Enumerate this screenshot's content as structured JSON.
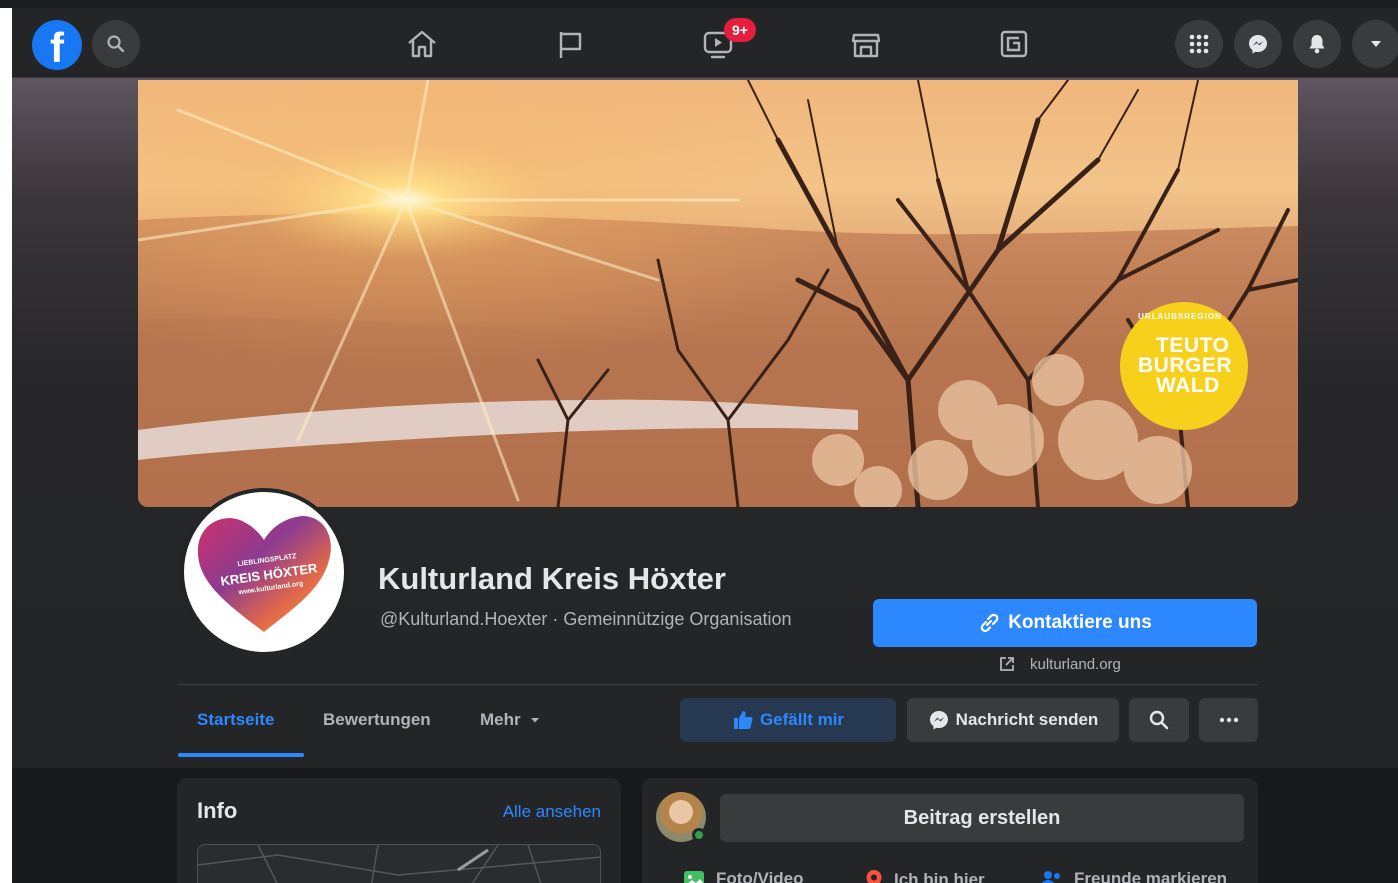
{
  "colors": {
    "background": "#18191a",
    "surface": "#242526",
    "accent": "#2d88ff",
    "notification": "#e41e3f",
    "brand_yellow": "#f7d01c"
  },
  "topnav": {
    "logo_letter": "f",
    "icons": [
      "search-icon",
      "home-icon",
      "flag-icon",
      "watch-icon",
      "marketplace-icon",
      "gaming-icon",
      "menu-grid-icon",
      "messenger-icon",
      "bell-icon",
      "caret-down-icon"
    ],
    "watch_badge": "9+"
  },
  "cover": {
    "badge_small": "URLAUBSREGION",
    "badge_line1": "TEUTO",
    "badge_line2": "BURGER",
    "badge_line3": "WALD"
  },
  "profile": {
    "avatar_line1": "LIEBLINGSPLATZ",
    "avatar_line2": "KREIS HÖXTER",
    "avatar_line3": "www.kulturland.org",
    "name": "Kulturland Kreis Höxter",
    "subtitle": "@Kulturland.Hoexter · Gemeinnützige Organisation",
    "contact_label": "Kontaktiere uns",
    "website": "kulturland.org"
  },
  "tabs": [
    {
      "label": "Startseite",
      "active": true
    },
    {
      "label": "Bewertungen",
      "active": false
    },
    {
      "label": "Mehr",
      "active": false
    }
  ],
  "actions": {
    "like_label": "Gefällt mir",
    "message_label": "Nachricht senden"
  },
  "info": {
    "title": "Info",
    "see_all": "Alle ansehen"
  },
  "composer": {
    "create_post": "Beitrag erstellen",
    "photo_video": "Foto/Video",
    "checkin": "Ich bin hier",
    "tag_friends": "Freunde markieren"
  }
}
